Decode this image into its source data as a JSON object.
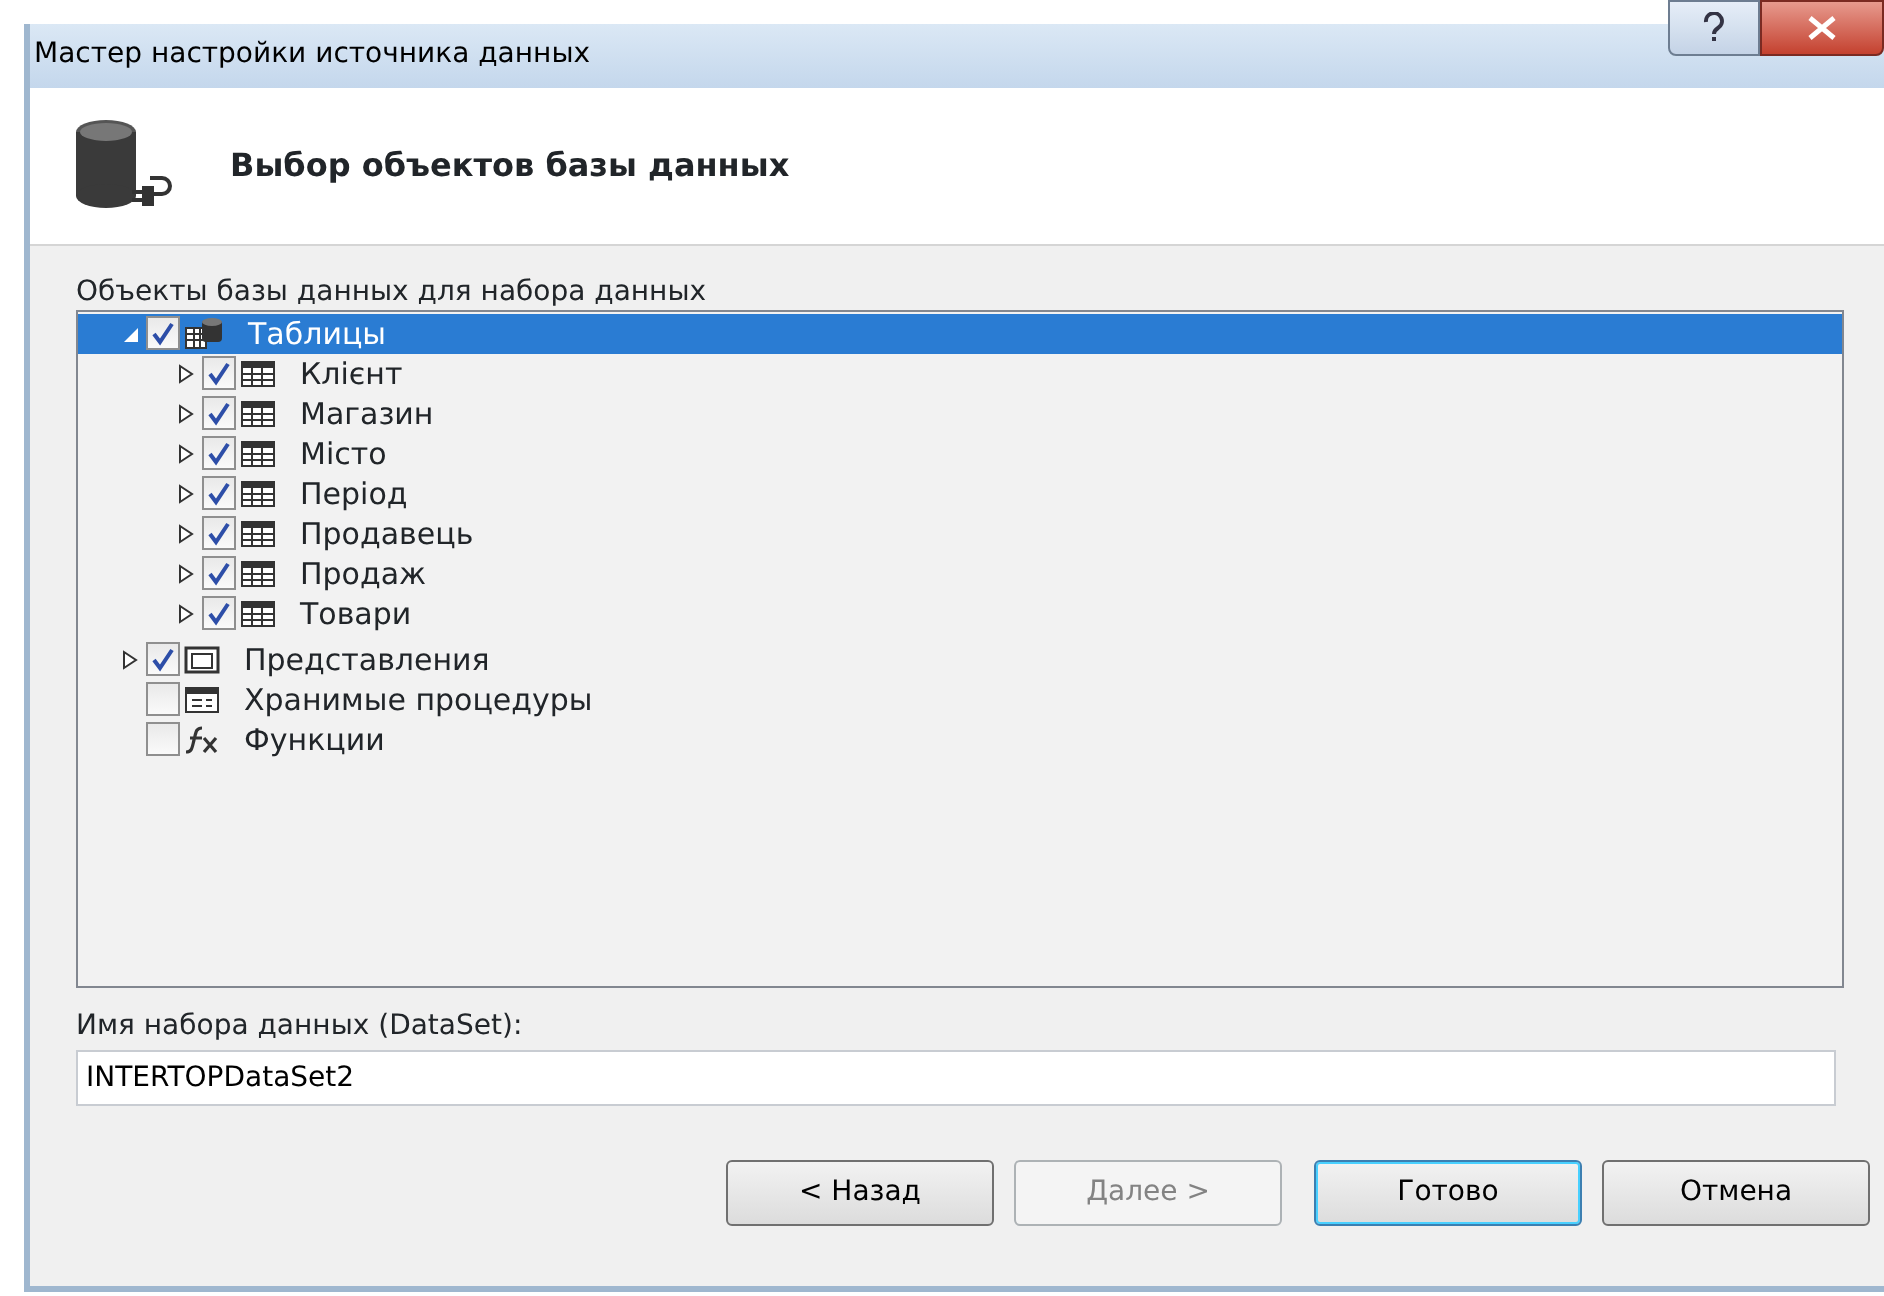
{
  "window": {
    "title": "Мастер настройки источника данных"
  },
  "header": {
    "title": "Выбор объектов базы данных"
  },
  "tree": {
    "label": "Объекты базы данных для набора данных",
    "items": [
      {
        "label": "Таблицы",
        "kind": "tables",
        "checked": true,
        "expanded": true,
        "selected": true,
        "children": [
          {
            "label": "Клієнт",
            "kind": "table",
            "checked": true,
            "expanded": false,
            "selected": false
          },
          {
            "label": "Магазин",
            "kind": "table",
            "checked": true,
            "expanded": false,
            "selected": false
          },
          {
            "label": "Місто",
            "kind": "table",
            "checked": true,
            "expanded": false,
            "selected": false
          },
          {
            "label": "Період",
            "kind": "table",
            "checked": true,
            "expanded": false,
            "selected": false
          },
          {
            "label": "Продавець",
            "kind": "table",
            "checked": true,
            "expanded": false,
            "selected": false
          },
          {
            "label": "Продаж",
            "kind": "table",
            "checked": true,
            "expanded": false,
            "selected": false
          },
          {
            "label": "Товари",
            "kind": "table",
            "checked": true,
            "expanded": false,
            "selected": false
          }
        ]
      },
      {
        "label": "Представления",
        "kind": "views",
        "checked": true,
        "expanded": false,
        "selected": false
      },
      {
        "label": "Хранимые процедуры",
        "kind": "procedures",
        "checked": false,
        "selected": false
      },
      {
        "label": "Функции",
        "kind": "functions",
        "checked": false,
        "selected": false
      }
    ]
  },
  "dataset": {
    "label": "Имя набора данных (DataSet):",
    "value": "INTERTOPDataSet2"
  },
  "buttons": [
    {
      "label": "< Назад",
      "disabled": false,
      "default": false
    },
    {
      "label": "Далее >",
      "disabled": true,
      "default": false
    },
    {
      "label": "Готово",
      "disabled": false,
      "default": true
    },
    {
      "label": "Отмена",
      "disabled": false,
      "default": false
    }
  ]
}
